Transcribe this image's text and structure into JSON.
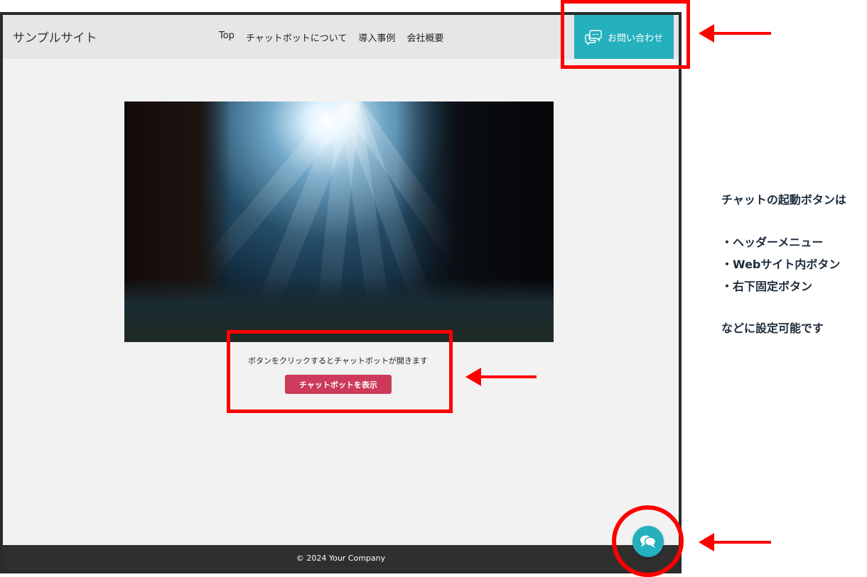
{
  "site": {
    "title": "サンプルサイト"
  },
  "nav": {
    "items": [
      {
        "label": "Top"
      },
      {
        "label": "チャットボットについて"
      },
      {
        "label": "導入事例"
      },
      {
        "label": "会社概要"
      }
    ]
  },
  "header_cta": {
    "label": "お問い合わせ"
  },
  "main": {
    "caption": "ボタンをクリックするとチャットボットが開きます",
    "chatbot_button": "チャットボットを表示"
  },
  "footer": {
    "copyright": "© 2024 Your Company"
  },
  "annotation": {
    "heading": "チャットの起動ボタンは",
    "items": [
      "・ヘッダーメニュー",
      "・Webサイト内ボタン",
      "・右下固定ボタン"
    ],
    "closing": "などに設定可能です"
  },
  "colors": {
    "accent": "#24b0bd",
    "chatbot_button": "#cd3a5a",
    "highlight": "#ff0000",
    "footer_bg": "#2f2f2f"
  },
  "icons": {
    "header_cta": "chat-bubbles-icon",
    "fab": "chat-bubbles-icon"
  }
}
